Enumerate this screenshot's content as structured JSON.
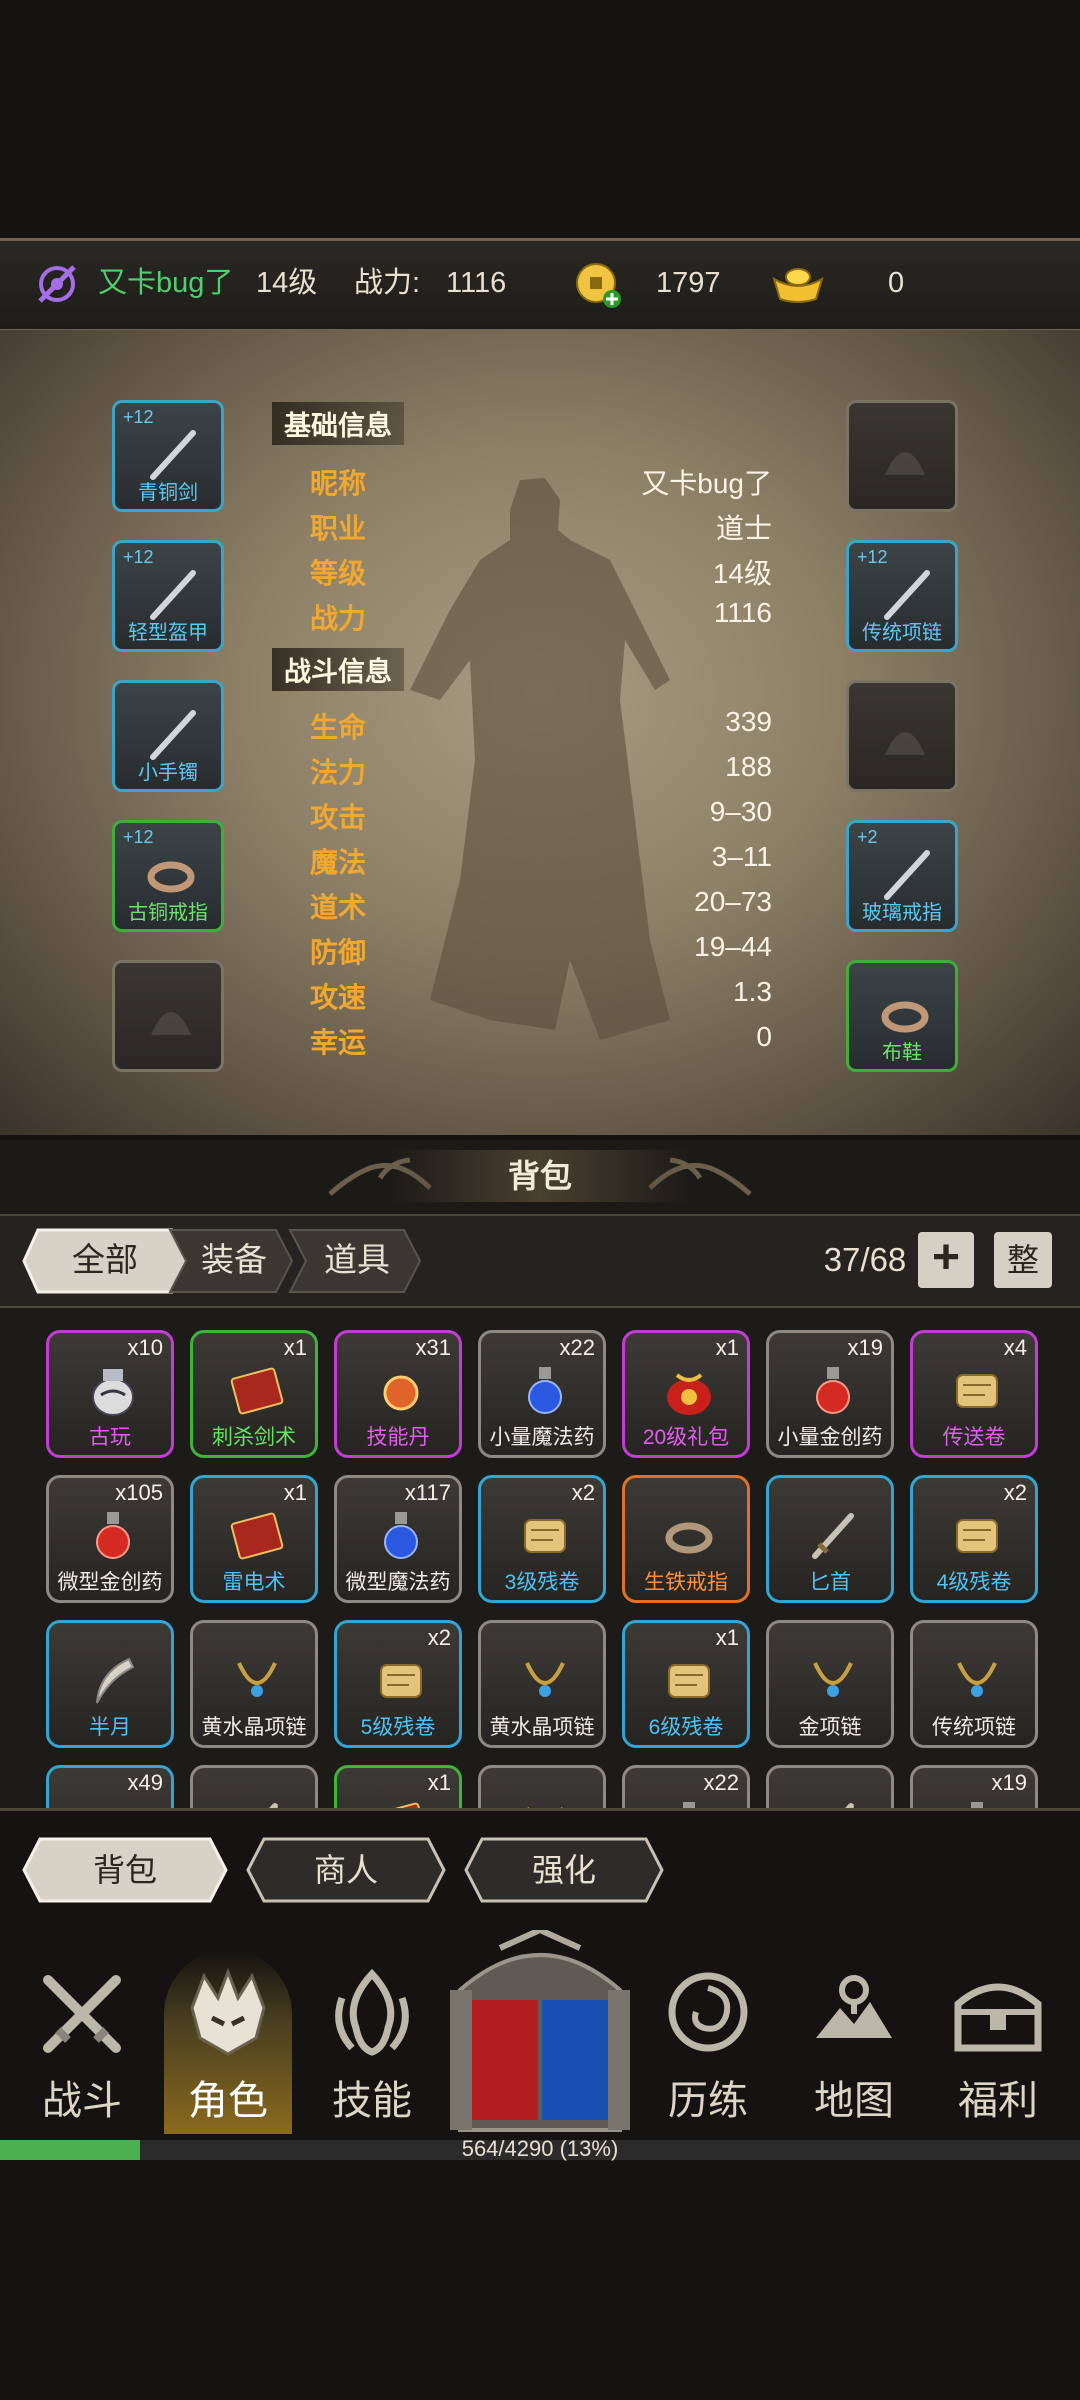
{
  "header": {
    "player_name": "又卡bug了",
    "level": "14级",
    "power_label": "战力:",
    "power_value": "1116",
    "coins": "1797",
    "ingots": "0"
  },
  "basic_info": {
    "title": "基础信息",
    "rows": [
      {
        "label": "昵称",
        "value": "又卡bug了"
      },
      {
        "label": "职业",
        "value": "道士"
      },
      {
        "label": "等级",
        "value": "14级"
      },
      {
        "label": "战力",
        "value": "1116"
      }
    ]
  },
  "combat_info": {
    "title": "战斗信息",
    "rows": [
      {
        "label": "生命",
        "value": "339"
      },
      {
        "label": "法力",
        "value": "188"
      },
      {
        "label": "攻击",
        "value": "9–30"
      },
      {
        "label": "魔法",
        "value": "3–11"
      },
      {
        "label": "道术",
        "value": "20–73"
      },
      {
        "label": "防御",
        "value": "19–44"
      },
      {
        "label": "攻速",
        "value": "1.3"
      },
      {
        "label": "幸运",
        "value": "0"
      }
    ]
  },
  "equipment_left": [
    {
      "name": "青铜剑",
      "plus": "+12",
      "rarity": "blue"
    },
    {
      "name": "轻型盔甲",
      "plus": "+12",
      "rarity": "blue"
    },
    {
      "name": "小手镯",
      "plus": "",
      "rarity": "blue"
    },
    {
      "name": "古铜戒指",
      "plus": "+12",
      "rarity": "green"
    },
    {
      "name": "",
      "plus": "",
      "rarity": "gray"
    }
  ],
  "equipment_right": [
    {
      "name": "",
      "plus": "",
      "rarity": "gray"
    },
    {
      "name": "传统项链",
      "plus": "+12",
      "rarity": "blue"
    },
    {
      "name": "",
      "plus": "",
      "rarity": "gray"
    },
    {
      "name": "玻璃戒指",
      "plus": "+2",
      "rarity": "blue"
    },
    {
      "name": "布鞋",
      "plus": "",
      "rarity": "green"
    }
  ],
  "bag": {
    "title": "背包",
    "tabs": [
      "全部",
      "装备",
      "道具"
    ],
    "capacity": "37/68",
    "add_label": "+",
    "sort_label": "整",
    "items": [
      {
        "name": "古玩",
        "count": "x10",
        "rarity": "purple",
        "icon": "vase-icon"
      },
      {
        "name": "刺杀剑术",
        "count": "x1",
        "rarity": "green",
        "icon": "book-icon"
      },
      {
        "name": "技能丹",
        "count": "x31",
        "rarity": "purple",
        "icon": "pill-icon"
      },
      {
        "name": "小量魔法药",
        "count": "x22",
        "rarity": "gray",
        "icon": "mana-potion-icon"
      },
      {
        "name": "20级礼包",
        "count": "x1",
        "rarity": "purple",
        "icon": "gift-bag-icon"
      },
      {
        "name": "小量金创药",
        "count": "x19",
        "rarity": "gray",
        "icon": "health-potion-icon"
      },
      {
        "name": "传送卷",
        "count": "x4",
        "rarity": "purple",
        "icon": "scroll-icon"
      },
      {
        "name": "微型金创药",
        "count": "x105",
        "rarity": "gray",
        "icon": "health-potion-icon"
      },
      {
        "name": "雷电术",
        "count": "x1",
        "rarity": "blue",
        "icon": "book-icon"
      },
      {
        "name": "微型魔法药",
        "count": "x117",
        "rarity": "gray",
        "icon": "mana-potion-icon"
      },
      {
        "name": "3级残卷",
        "count": "x2",
        "rarity": "blue",
        "icon": "scroll-icon"
      },
      {
        "name": "生铁戒指",
        "count": "",
        "rarity": "orange",
        "icon": "ring-icon"
      },
      {
        "name": "匕首",
        "count": "",
        "rarity": "blue",
        "icon": "dagger-icon"
      },
      {
        "name": "4级残卷",
        "count": "x2",
        "rarity": "blue",
        "icon": "scroll-icon"
      },
      {
        "name": "半月",
        "count": "",
        "rarity": "blue",
        "icon": "crescent-blade-icon"
      },
      {
        "name": "黄水晶项链",
        "count": "",
        "rarity": "gray",
        "icon": "necklace-icon"
      },
      {
        "name": "5级残卷",
        "count": "x2",
        "rarity": "blue",
        "icon": "scroll-icon"
      },
      {
        "name": "黄水晶项链",
        "count": "",
        "rarity": "gray",
        "icon": "necklace-icon"
      },
      {
        "name": "6级残卷",
        "count": "x1",
        "rarity": "blue",
        "icon": "scroll-icon"
      },
      {
        "name": "金项链",
        "count": "",
        "rarity": "gray",
        "icon": "necklace-icon"
      },
      {
        "name": "传统项链",
        "count": "",
        "rarity": "gray",
        "icon": "necklace-icon"
      },
      {
        "name": "",
        "count": "x49",
        "rarity": "blue",
        "icon": "scroll-icon"
      },
      {
        "name": "",
        "count": "",
        "rarity": "gray",
        "icon": "dagger-icon"
      },
      {
        "name": "",
        "count": "x1",
        "rarity": "green",
        "icon": "book-icon"
      },
      {
        "name": "",
        "count": "",
        "rarity": "gray",
        "icon": "necklace-icon"
      },
      {
        "name": "",
        "count": "x22",
        "rarity": "gray",
        "icon": "mana-potion-icon"
      },
      {
        "name": "",
        "count": "",
        "rarity": "gray",
        "icon": "dagger-icon"
      },
      {
        "name": "",
        "count": "x19",
        "rarity": "gray",
        "icon": "health-potion-icon"
      }
    ]
  },
  "sub_tabs": [
    "背包",
    "商人",
    "强化"
  ],
  "nav": [
    {
      "label": "战斗",
      "icon": "crossed-swords-icon"
    },
    {
      "label": "角色",
      "icon": "crown-mask-icon"
    },
    {
      "label": "技能",
      "icon": "flame-icon"
    },
    {
      "label": "",
      "icon": "portal-gate-icon"
    },
    {
      "label": "历练",
      "icon": "vortex-icon"
    },
    {
      "label": "地图",
      "icon": "map-icon"
    },
    {
      "label": "福利",
      "icon": "treasure-chest-icon"
    }
  ],
  "xp": {
    "text": "564/4290 (13%)",
    "fraction": 0.13
  },
  "colors": {
    "accent_gold": "#f0a830",
    "rarity_blue": "#31a5d3",
    "rarity_purple": "#c43cd6",
    "rarity_green": "#3fb43a",
    "rarity_orange": "#e0702a",
    "xp_green": "#4caf50"
  }
}
